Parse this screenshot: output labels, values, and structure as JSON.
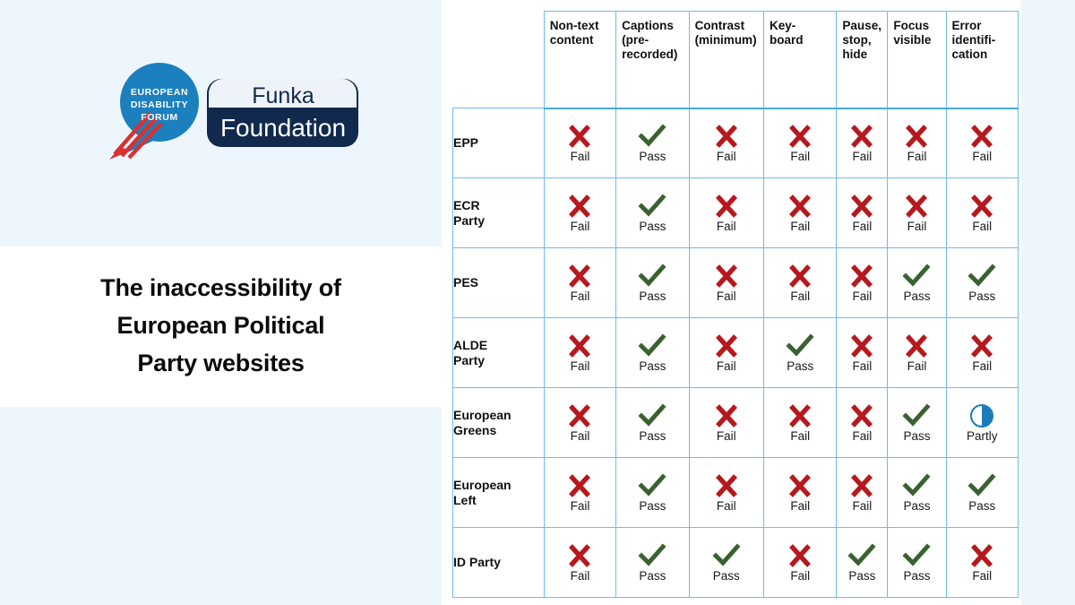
{
  "slide": {
    "title_lines": [
      "The inaccessibility of",
      "European Political",
      "Party websites"
    ],
    "background_color": "#eef6fd",
    "band_color": "#ffffff"
  },
  "logos": {
    "edf": {
      "name": "european-disability-forum-logo",
      "line1": "EUROPEAN",
      "line2": "DISABILITY",
      "line3": "FORUM",
      "circle_color": "#1c7fbe",
      "stripe_color": "#d93030"
    },
    "funka": {
      "name": "funka-foundation-logo",
      "line1": "Funka",
      "line2": "Foundation",
      "frame_color": "#11294d",
      "inner_color": "#eef3fa"
    }
  },
  "legend": {
    "pass_label": "Pass",
    "fail_label": "Fail",
    "partly_label": "Partly",
    "pass_color": "#3a6130",
    "fail_color": "#b5191e",
    "partly_color": "#1b7cb8"
  },
  "table": {
    "corner_label": "",
    "border_color": "#6cbdec",
    "columns": [
      "Non-text content",
      "Captions (pre-recorded)",
      "Contrast (minimum)",
      "Key-board",
      "Pause, stop, hide",
      "Focus visible",
      "Error identifi-cation"
    ],
    "column_lines": [
      [
        "Non-text",
        "content"
      ],
      [
        "Captions",
        "(pre-",
        "recorded)"
      ],
      [
        "Contrast",
        "(minimum)"
      ],
      [
        "Key-",
        "board"
      ],
      [
        "Pause,",
        "stop,",
        "hide"
      ],
      [
        "Focus",
        "visible"
      ],
      [
        "Error",
        "identifi-",
        "cation"
      ]
    ],
    "rows": [
      {
        "label": "EPP",
        "label_lines": [
          "EPP"
        ],
        "results": [
          "fail",
          "pass",
          "fail",
          "fail",
          "fail",
          "fail",
          "fail"
        ],
        "result_labels": [
          "Fail",
          "Pass",
          "Fail",
          "Fail",
          "Fail",
          "Fail",
          "Fail"
        ]
      },
      {
        "label": "ECR Party",
        "label_lines": [
          "ECR",
          "Party"
        ],
        "results": [
          "fail",
          "pass",
          "fail",
          "fail",
          "fail",
          "fail",
          "fail"
        ],
        "result_labels": [
          "Fail",
          "Pass",
          "Fail",
          "Fail",
          "Fail",
          "Fail",
          "Fail"
        ]
      },
      {
        "label": "PES",
        "label_lines": [
          "PES"
        ],
        "results": [
          "fail",
          "pass",
          "fail",
          "fail",
          "fail",
          "pass",
          "pass"
        ],
        "result_labels": [
          "Fail",
          "Pass",
          "Fail",
          "Fail",
          "Fail",
          "Pass",
          "Pass"
        ]
      },
      {
        "label": "ALDE Party",
        "label_lines": [
          "ALDE",
          "Party"
        ],
        "results": [
          "fail",
          "pass",
          "fail",
          "pass",
          "fail",
          "fail",
          "fail"
        ],
        "result_labels": [
          "Fail",
          "Pass",
          "Fail",
          "Pass",
          "Fail",
          "Fail",
          "Fail"
        ]
      },
      {
        "label": "European Greens",
        "label_lines": [
          "European",
          "Greens"
        ],
        "results": [
          "fail",
          "pass",
          "fail",
          "fail",
          "fail",
          "pass",
          "partly"
        ],
        "result_labels": [
          "Fail",
          "Pass",
          "Fail",
          "Fail",
          "Fail",
          "Pass",
          "Partly"
        ]
      },
      {
        "label": "European Left",
        "label_lines": [
          "European",
          "Left"
        ],
        "results": [
          "fail",
          "pass",
          "fail",
          "fail",
          "fail",
          "pass",
          "pass"
        ],
        "result_labels": [
          "Fail",
          "Pass",
          "Fail",
          "Fail",
          "Fail",
          "Pass",
          "Pass"
        ]
      },
      {
        "label": "ID Party",
        "label_lines": [
          "ID Party"
        ],
        "results": [
          "fail",
          "pass",
          "pass",
          "fail",
          "pass",
          "pass",
          "fail"
        ],
        "result_labels": [
          "Fail",
          "Pass",
          "Pass",
          "Fail",
          "Pass",
          "Pass",
          "Fail"
        ]
      }
    ]
  }
}
